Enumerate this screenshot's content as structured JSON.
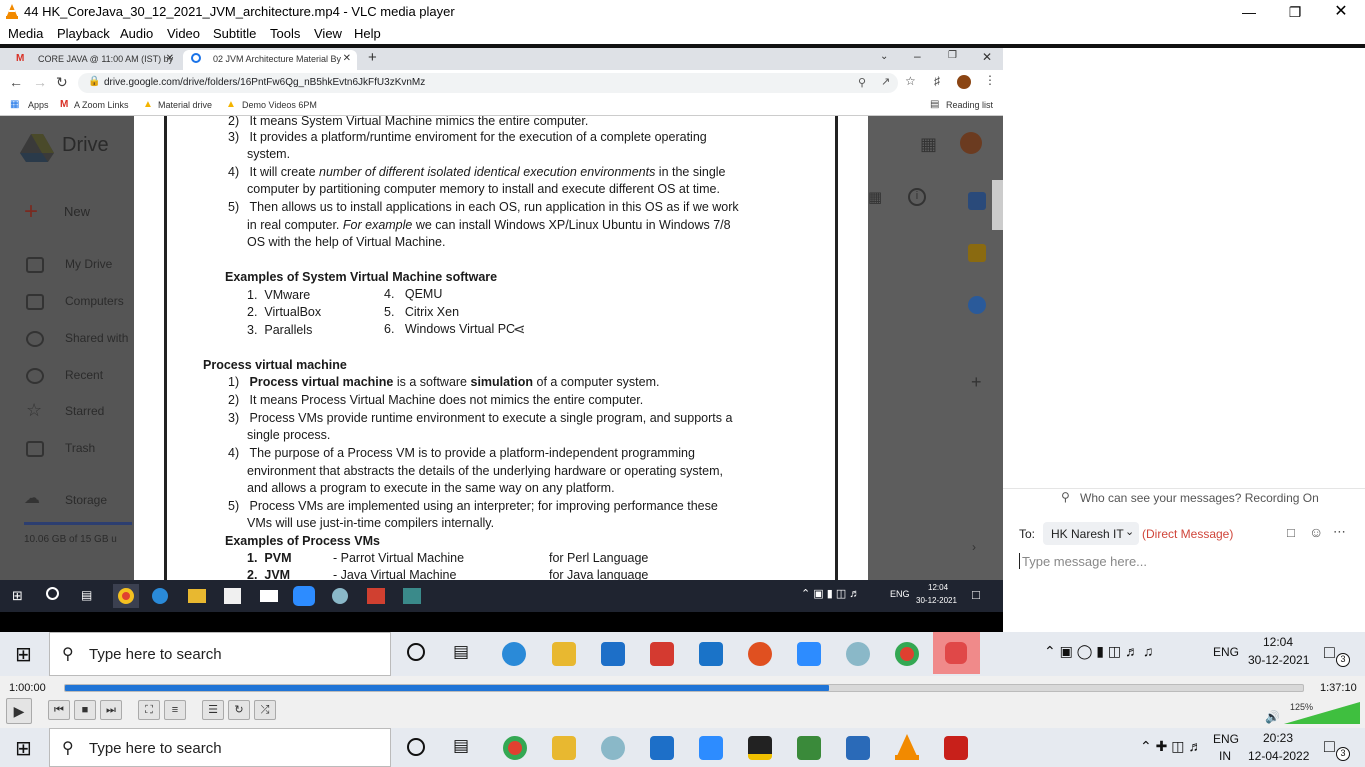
{
  "vlc": {
    "title": "44 HK_CoreJava_30_12_2021_JVM_architecture.mp4 - VLC media player",
    "menu": [
      "Media",
      "Playback",
      "Audio",
      "Video",
      "Subtitle",
      "Tools",
      "View",
      "Help"
    ],
    "time_elapsed": "1:00:00",
    "time_total": "1:37:10",
    "progress_fraction": 0.617,
    "volume": "125%",
    "volume_fraction": 1.0
  },
  "chrome": {
    "tabs": [
      "CORE JAVA @ 11:00 AM (IST) by",
      "02 JVM Architecture Material By"
    ],
    "url": "drive.google.com/drive/folders/16PntFw6Qg_nB5hkEvtn6JkFfU3zKvnMz",
    "bookmarks": [
      "Apps",
      "A Zoom Links",
      "Material drive",
      "Demo Videos 6PM"
    ],
    "reading_list": "Reading list"
  },
  "drive": {
    "logo": "Drive",
    "new_label": "New",
    "nav": [
      "My Drive",
      "Computers",
      "Shared with",
      "Recent",
      "Starred",
      "Trash",
      "Storage"
    ],
    "storage_text": "10.06 GB of 15 GB u"
  },
  "doc": {
    "sys_items": [
      {
        "n": "2)",
        "text": "It means System Virtual Machine mimics the entire computer."
      },
      {
        "n": "3)",
        "text": "It provides a platform/runtime enviroment for the execution of a complete operating"
      },
      {
        "n": "",
        "text": "system."
      },
      {
        "n": "4)",
        "pre": "It will create ",
        "em": "number of different isolated identical execution environments",
        "post": " in the single"
      },
      {
        "n": "",
        "text": "computer by partitioning computer memory to install and execute different OS at time."
      },
      {
        "n": "5)",
        "text": "Then allows us to install applications in each OS, run application in this OS as if we work"
      },
      {
        "n": "",
        "pre": "in real computer. ",
        "em": "For example",
        "post": " we can install Windows XP/Linux Ubuntu in Windows 7/8"
      },
      {
        "n": "",
        "text": "OS with the help of Virtual Machine."
      }
    ],
    "sys_examples_heading": "Examples of System Virtual Machine software",
    "sys_examples": [
      {
        "n": "1.",
        "text": "VMware"
      },
      {
        "n": "4.",
        "text": "QEMU"
      },
      {
        "n": "2.",
        "text": "VirtualBox"
      },
      {
        "n": "5.",
        "text": "Citrix Xen"
      },
      {
        "n": "3.",
        "text": "Parallels"
      },
      {
        "n": "6.",
        "text": "Windows Virtual PC"
      }
    ],
    "process_heading": "Process virtual machine",
    "proc_items": [
      {
        "n": "1)",
        "b1": "Process virtual machine",
        "mid": " is a software ",
        "b2": "simulation",
        "post": " of a computer system."
      },
      {
        "n": "2)",
        "text": "It means Process Virtual Machine does not mimics the entire computer."
      },
      {
        "n": "3)",
        "text": "Process VMs provide runtime environment to execute a single program, and supports a"
      },
      {
        "n": "",
        "text": "single process."
      },
      {
        "n": "4)",
        "text": "The purpose of a Process VM is to provide a platform-independent programming"
      },
      {
        "n": "",
        "text": "environment that abstracts the details of the underlying hardware or operating system,"
      },
      {
        "n": "",
        "text": "and allows a program to execute in the same way on any platform."
      },
      {
        "n": "5)",
        "text": "Process VMs are implemented using an interpreter; for improving performance these"
      },
      {
        "n": "",
        "text": "VMs will use just-in-time compilers internally."
      }
    ],
    "proc_examples_heading": "Examples of Process VMs",
    "proc_examples": [
      {
        "n": "1.",
        "abbr": "PVM",
        "full": "- Parrot Virtual Machine",
        "lang": "for Perl Language"
      },
      {
        "n": "2.",
        "abbr": "JVM",
        "full": "- Java Virtual Machine",
        "lang": "for Java language"
      }
    ]
  },
  "inner_taskbar": {
    "lang": "ENG",
    "time": "12:04",
    "date": "30-12-2021"
  },
  "zoom_chat": {
    "privacy": "Who can see your messages? Recording On",
    "to_label": "To:",
    "recipient": "HK Naresh IT",
    "direct": "(Direct Message)",
    "placeholder": "Type message here..."
  },
  "taskbar1": {
    "search": "Type here to search",
    "lang": "ENG",
    "time": "12:04",
    "date": "30-12-2021",
    "notif": "3"
  },
  "taskbar2": {
    "search": "Type here to search",
    "lang": "ENG",
    "lang2": "IN",
    "time": "20:23",
    "date": "12-04-2022",
    "notif": "3"
  },
  "colors": {
    "vlc_progress": "#1f74d6",
    "drive_bg": "#5d5d5d",
    "accent_red": "#d93025"
  }
}
